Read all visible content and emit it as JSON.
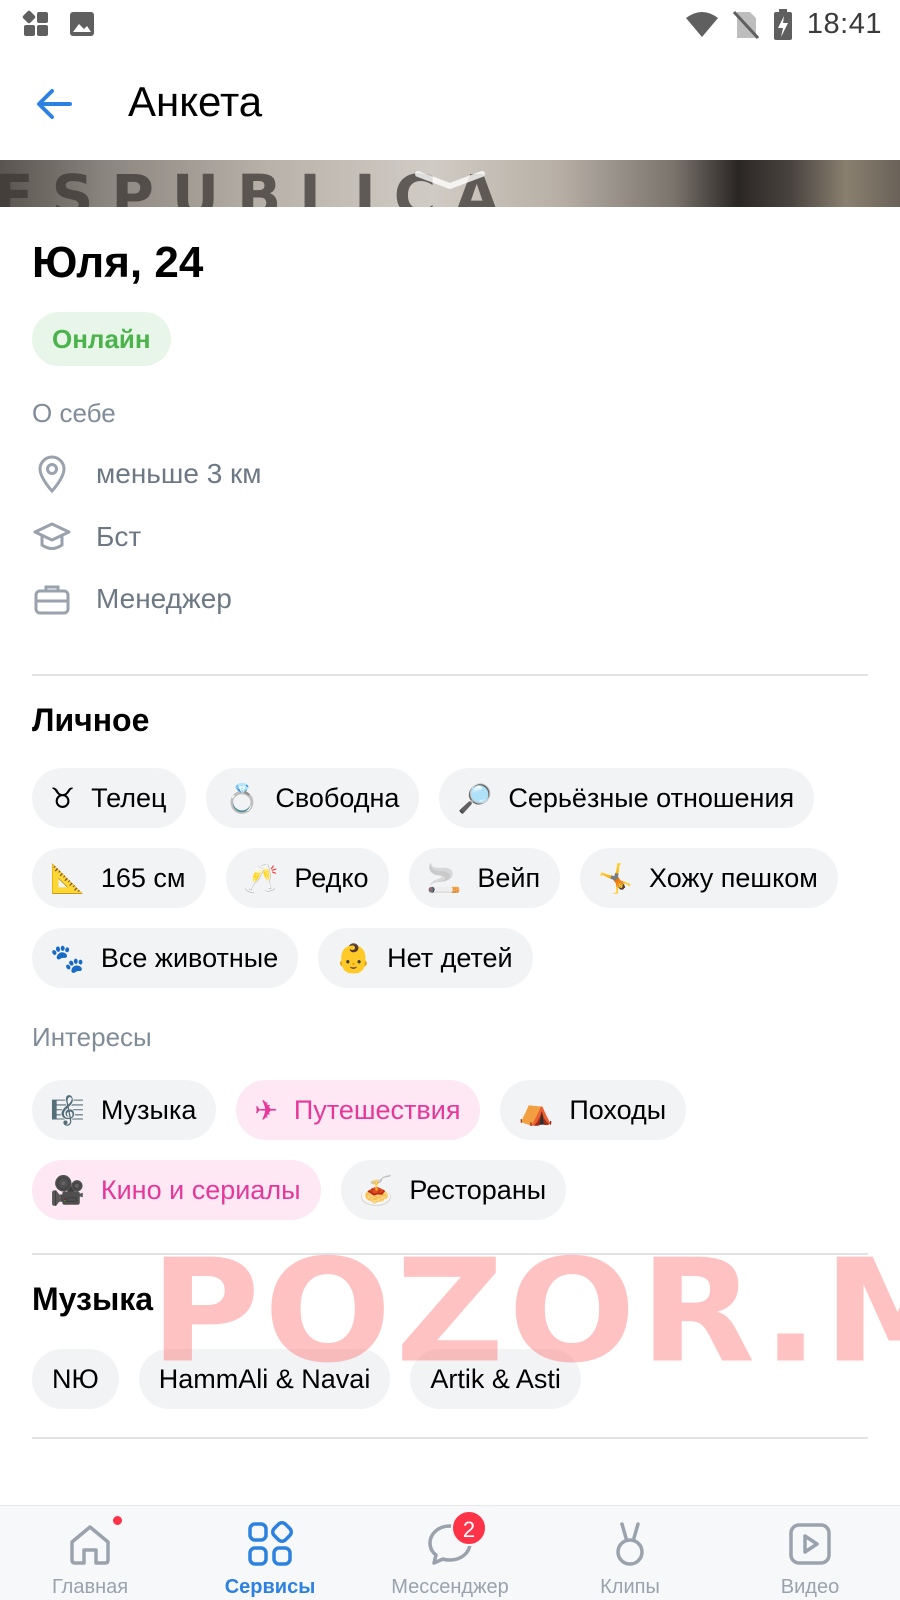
{
  "status_bar": {
    "time": "18:41"
  },
  "header": {
    "title": "Анкета"
  },
  "profile": {
    "name": "Юля, 24",
    "status": "Онлайн",
    "about_label": "О себе",
    "photo_caption_text": "ESPUBLICA",
    "info": [
      {
        "icon": "location-pin-icon",
        "text": "меньше 3 км"
      },
      {
        "icon": "graduation-cap-icon",
        "text": "Бст"
      },
      {
        "icon": "briefcase-icon",
        "text": "Менеджер"
      }
    ]
  },
  "personal": {
    "title": "Личное",
    "chips": [
      {
        "emoji": "♉",
        "label": "Телец"
      },
      {
        "emoji": "💍",
        "label": "Свободна"
      },
      {
        "emoji": "🔎",
        "label": "Серьёзные отношения"
      },
      {
        "emoji": "📐",
        "label": "165 см"
      },
      {
        "emoji": "🥂",
        "label": "Редко"
      },
      {
        "emoji": "🚬",
        "label": "Вейп"
      },
      {
        "emoji": "🤸",
        "label": "Хожу пешком"
      },
      {
        "emoji": "🐾",
        "label": "Все животные"
      },
      {
        "emoji": "👶",
        "label": "Нет детей"
      }
    ]
  },
  "interests": {
    "title": "Интересы",
    "chips": [
      {
        "emoji": "🎼",
        "label": "Музыка",
        "highlight": false
      },
      {
        "emoji": "✈",
        "label": "Путешествия",
        "highlight": true
      },
      {
        "emoji": "⛺",
        "label": "Походы",
        "highlight": false
      },
      {
        "emoji": "🎥",
        "label": "Кино и сериалы",
        "highlight": true
      },
      {
        "emoji": "🍝",
        "label": "Рестораны",
        "highlight": false
      }
    ]
  },
  "music": {
    "title": "Музыка",
    "chips": [
      "NЮ",
      "HammAli & Navai",
      "Artik & Asti"
    ]
  },
  "watermark": "POZOR.ME",
  "bottom_nav": {
    "items": [
      {
        "label": "Главная",
        "icon": "home-icon",
        "active": false,
        "dot": true
      },
      {
        "label": "Сервисы",
        "icon": "services-icon",
        "active": true
      },
      {
        "label": "Мессенджер",
        "icon": "messenger-icon",
        "active": false,
        "badge": "2"
      },
      {
        "label": "Клипы",
        "icon": "clips-icon",
        "active": false
      },
      {
        "label": "Видео",
        "icon": "video-icon",
        "active": false
      }
    ]
  },
  "colors": {
    "accent": "#2d81e0",
    "online": "#4bb34b",
    "highlight_text": "#e6379a",
    "badge": "#ff3347"
  }
}
